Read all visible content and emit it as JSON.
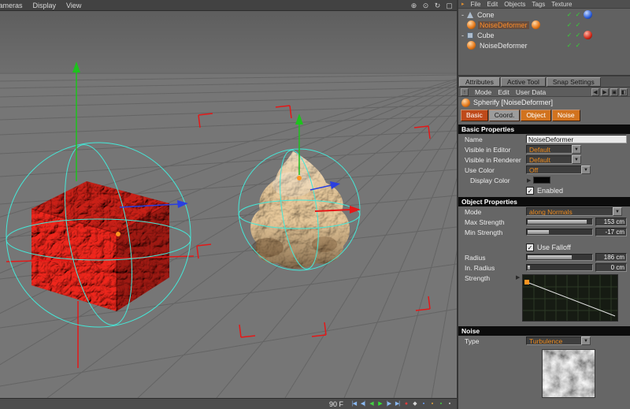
{
  "icons": {
    "check": "✓",
    "dropdown_arrow": "▼",
    "triangle_right": "▶",
    "expander": "-",
    "om_menu_icon": "▸",
    "am_menu_icon": "↑",
    "nav_left": "◀",
    "nav_right": "▶",
    "lock": "▣",
    "pin": "◧"
  },
  "viewport": {
    "menu": [
      "Cameras",
      "Display",
      "View"
    ],
    "corner_tools": [
      {
        "name": "pan",
        "glyph": "⊕"
      },
      {
        "name": "zoom",
        "glyph": "⊙"
      },
      {
        "name": "rotate",
        "glyph": "↻"
      },
      {
        "name": "maximize",
        "glyph": "▢"
      }
    ],
    "timeline": {
      "frame": "90 F",
      "icons": [
        {
          "name": "goto-start",
          "glyph": "|◀",
          "color": "#8ab8f0"
        },
        {
          "name": "prev-key",
          "glyph": "◀|",
          "color": "#8ab8f0"
        },
        {
          "name": "prev-frame",
          "glyph": "◀",
          "color": "#43cf43"
        },
        {
          "name": "play",
          "glyph": "▶",
          "color": "#31e431"
        },
        {
          "name": "next-key",
          "glyph": "|▶",
          "color": "#8ab8f0"
        },
        {
          "name": "goto-end",
          "glyph": "▶|",
          "color": "#8ab8f0"
        },
        {
          "name": "record",
          "glyph": "●",
          "color": "#e03c3c"
        },
        {
          "name": "autokey",
          "glyph": "◆",
          "color": "#d6d6d6"
        },
        {
          "name": "key-position",
          "glyph": "▪",
          "color": "#6d9df2"
        },
        {
          "name": "key-scale",
          "glyph": "▪",
          "color": "#e0a43c"
        },
        {
          "name": "key-rotation",
          "glyph": "▪",
          "color": "#43cf43"
        },
        {
          "name": "key-parameter",
          "glyph": "▪",
          "color": "#cccccc"
        }
      ]
    }
  },
  "object_manager": {
    "menu": [
      "File",
      "Edit",
      "Objects",
      "Tags",
      "Texture"
    ],
    "tree": [
      {
        "label": "Cone"
      },
      {
        "label": "NoiseDeformer"
      },
      {
        "label": "Cube"
      },
      {
        "label": "NoiseDeformer"
      }
    ]
  },
  "panel_tabs": [
    {
      "label": "Attributes"
    },
    {
      "label": "Active Tool"
    },
    {
      "label": "Snap Settings"
    }
  ],
  "attributes": {
    "menu": [
      "Mode",
      "Edit",
      "User Data"
    ],
    "title": "Spherify [NoiseDeformer]",
    "page_tabs": [
      {
        "label": "Basic",
        "bg": "#bf4a1a",
        "fg": "#ffffff"
      },
      {
        "label": "Coord.",
        "bg": "#9c9c9c",
        "fg": "#141414"
      },
      {
        "label": "Object",
        "bg": "#d2731e",
        "fg": "#ffffff"
      },
      {
        "label": "Noise",
        "bg": "#d2731e",
        "fg": "#ffffff"
      }
    ],
    "basic": {
      "header": "Basic Properties",
      "name_label": "Name",
      "name_value": "NoiseDeformer",
      "visible_editor_label": "Visible in Editor",
      "visible_editor_value": "Default",
      "visible_renderer_label": "Visible in Renderer",
      "visible_renderer_value": "Default",
      "use_color_label": "Use Color",
      "use_color_value": "Off",
      "display_color_label": "Display Color",
      "enabled_label": "Enabled"
    },
    "object": {
      "header": "Object Properties",
      "mode_label": "Mode",
      "mode_value": "along Normals",
      "max_strength_label": "Max Strength",
      "max_strength_value": "153 cm",
      "max_strength_fill": "90%",
      "min_strength_label": "Min Strength",
      "min_strength_value": "-17 cm",
      "min_strength_fill": "32%",
      "use_falloff_label": "Use Falloff",
      "radius_label": "Radius",
      "radius_value": "186 cm",
      "radius_fill": "68%",
      "inner_radius_label": "In. Radius",
      "inner_radius_value": "0 cm",
      "inner_radius_fill": "4%",
      "strength_label": "Strength"
    },
    "noise": {
      "header": "Noise",
      "type_label": "Type",
      "type_value": "Turbulence"
    }
  }
}
